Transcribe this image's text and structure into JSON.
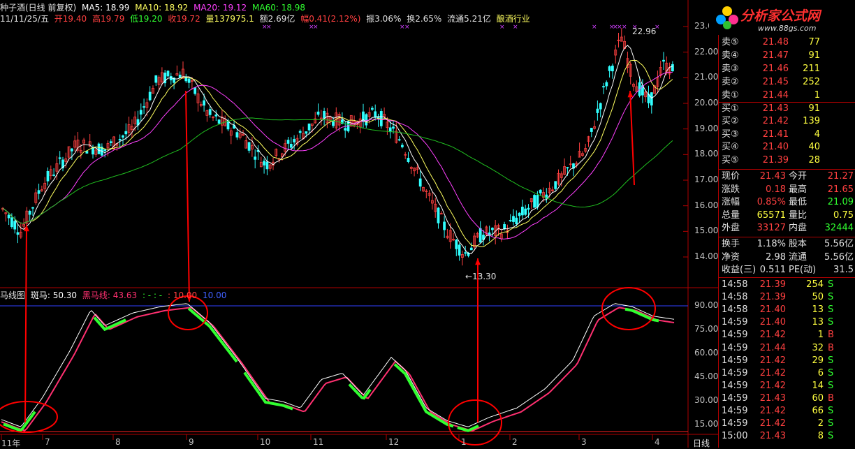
{
  "header": {
    "title": "种子酒(日线 前复权)",
    "ma5": "MA5: 18.99",
    "ma10": "MA10: 18.92",
    "ma20": "MA20: 19.12",
    "ma60": "MA60: 18.98",
    "date": "11/11/25/五",
    "open": "开19.40",
    "high": "高19.79",
    "low": "低19.20",
    "close": "收19.72",
    "volume": "量137975.1",
    "amount": "额2.69亿",
    "change": "幅0.41(2.12%)",
    "amplitude": "振3.06%",
    "turnover": "换2.65%",
    "float": "流通5.21亿",
    "industry": "酿酒行业"
  },
  "sub_header": {
    "name": "马线图",
    "zebra": "斑马: 50.30",
    "black": "黑马线: 43.63",
    "dots": ": - : -",
    "v1": ": 10.00",
    "v2": "10.00"
  },
  "annotations": {
    "peak": "22.96",
    "trough": "13.30"
  },
  "price_axis": [
    "23.00",
    "22.00",
    "21.00",
    "20.00",
    "19.00",
    "18.00",
    "17.00",
    "16.00",
    "15.00",
    "14.00"
  ],
  "osc_axis": [
    "90.00",
    "75.00",
    "60.00",
    "45.00",
    "30.00",
    "15.00"
  ],
  "time_axis": [
    "11年",
    "7",
    "8",
    "9",
    "10",
    "11",
    "12",
    "1",
    "2",
    "3",
    "4"
  ],
  "period_label": "日线",
  "logo": {
    "text": "分析家公式网",
    "url": "www.88gs.com"
  },
  "order_book": {
    "sells": [
      {
        "label": "卖⑤",
        "price": "21.48",
        "vol": "77"
      },
      {
        "label": "卖④",
        "price": "21.47",
        "vol": "91"
      },
      {
        "label": "卖③",
        "price": "21.46",
        "vol": "211"
      },
      {
        "label": "卖②",
        "price": "21.45",
        "vol": "252"
      },
      {
        "label": "卖①",
        "price": "21.44",
        "vol": "1"
      }
    ],
    "buys": [
      {
        "label": "买①",
        "price": "21.43",
        "vol": "91"
      },
      {
        "label": "买②",
        "price": "21.42",
        "vol": "139"
      },
      {
        "label": "买③",
        "price": "21.41",
        "vol": "4"
      },
      {
        "label": "买④",
        "price": "21.40",
        "vol": "40"
      },
      {
        "label": "买⑤",
        "price": "21.39",
        "vol": "28"
      }
    ]
  },
  "quote": [
    {
      "l1": "现价",
      "v1": "21.43",
      "l2": "今开",
      "v2": "21.27",
      "c1": "#ff4040",
      "c2": "#ff4040"
    },
    {
      "l1": "涨跌",
      "v1": "0.18",
      "l2": "最高",
      "v2": "21.65",
      "c1": "#ff4040",
      "c2": "#ff4040"
    },
    {
      "l1": "涨幅",
      "v1": "0.85%",
      "l2": "最低",
      "v2": "21.09",
      "c1": "#ff4040",
      "c2": "#30ff30"
    },
    {
      "l1": "总量",
      "v1": "65571",
      "l2": "量比",
      "v2": "0.75",
      "c1": "#ffff40",
      "c2": "#ffff40"
    },
    {
      "l1": "外盘",
      "v1": "33127",
      "l2": "内盘",
      "v2": "32444",
      "c1": "#ff4040",
      "c2": "#30ff30"
    }
  ],
  "fundamentals": [
    {
      "l1": "换手",
      "v1": "1.18%",
      "l2": "股本",
      "v2": "5.56亿"
    },
    {
      "l1": "净资",
      "v1": "2.98",
      "l2": "流通",
      "v2": "5.56亿"
    },
    {
      "l1": "收益(三)",
      "v1": "0.511",
      "l2": "PE(动)",
      "v2": "31.5"
    }
  ],
  "ticks": [
    {
      "time": "14:58",
      "price": "21.39",
      "vol": "254",
      "side": "S"
    },
    {
      "time": "14:58",
      "price": "21.39",
      "vol": "50",
      "side": "S"
    },
    {
      "time": "14:58",
      "price": "21.40",
      "vol": "13",
      "side": "S"
    },
    {
      "time": "14:59",
      "price": "21.40",
      "vol": "13",
      "side": "S"
    },
    {
      "time": "14:59",
      "price": "21.42",
      "vol": "1",
      "side": "B"
    },
    {
      "time": "14:59",
      "price": "21.44",
      "vol": "32",
      "side": "B"
    },
    {
      "time": "14:59",
      "price": "21.42",
      "vol": "29",
      "side": "S"
    },
    {
      "time": "14:59",
      "price": "21.42",
      "vol": "6",
      "side": "S"
    },
    {
      "time": "14:59",
      "price": "21.42",
      "vol": "14",
      "side": "S"
    },
    {
      "time": "14:59",
      "price": "21.43",
      "vol": "60",
      "side": "B"
    },
    {
      "time": "14:59",
      "price": "21.42",
      "vol": "66",
      "side": "S"
    },
    {
      "time": "14:59",
      "price": "21.42",
      "vol": "2",
      "side": "S"
    },
    {
      "time": "15:00",
      "price": "21.43",
      "vol": "8",
      "side": "S"
    }
  ],
  "colors": {
    "up": "#ff4040",
    "down": "#30ffff",
    "ma5": "#ffffff",
    "ma10": "#ffff60",
    "ma20": "#ff40ff",
    "ma60": "#20c020",
    "grid": "#b00000",
    "zebra": "#ffffff",
    "black_line": "#ff3070",
    "green_seg": "#30ff30",
    "marker": "#ff0000"
  }
}
